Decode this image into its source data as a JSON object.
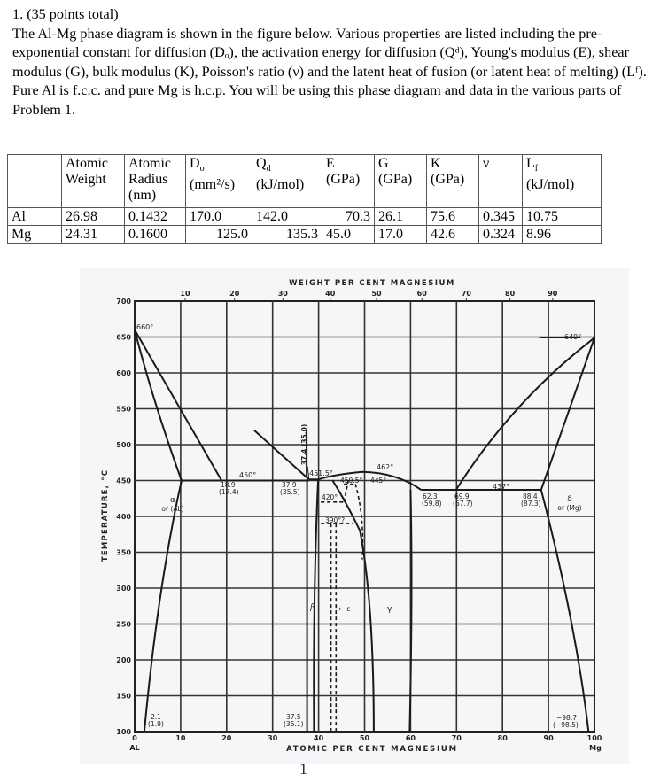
{
  "problem": {
    "heading": "1. (35 points total)",
    "paragraph": "The Al-Mg phase diagram is shown in the figure below.  Various properties are listed including the pre-exponential constant for diffusion (Dₒ), the activation energy for diffusion (Qᵈ), Young's modulus (E), shear modulus (G), bulk modulus (K), Poisson's ratio (ν) and the latent heat of fusion (or latent heat of melting) (Lᶠ).  Pure Al is f.c.c. and pure Mg is h.c.p.  You will be using this phase diagram and data in the various parts of Problem 1."
  },
  "table": {
    "headers": [
      {
        "line1": "",
        "line2": "",
        "line3": ""
      },
      {
        "line1": "Atomic",
        "line2": "Weight",
        "line3": ""
      },
      {
        "line1": "Atomic",
        "line2": "Radius",
        "line3": "(nm)"
      },
      {
        "line1": "D",
        "sub": "o",
        "line2": "(mm²/s)",
        "line3": ""
      },
      {
        "line1": "Q",
        "sub": "d",
        "line2": "(kJ/mol)",
        "line3": ""
      },
      {
        "line1": "E",
        "line2": "(GPa)",
        "line3": ""
      },
      {
        "line1": "G",
        "line2": "(GPa)",
        "line3": ""
      },
      {
        "line1": "K",
        "line2": "(GPa)",
        "line3": ""
      },
      {
        "line1": "ν",
        "line2": "",
        "line3": ""
      },
      {
        "line1": "L",
        "sub": "f",
        "line2": "(kJ/mol)",
        "line3": ""
      }
    ],
    "rows": [
      {
        "element": "Al",
        "atomic_weight": "26.98",
        "atomic_radius": "0.1432",
        "D0": "170.0",
        "Qd": "142.0",
        "E": "70.3",
        "G": "26.1",
        "K": "75.6",
        "nu": "0.345",
        "Lf": "10.75"
      },
      {
        "element": "Mg",
        "atomic_weight": "24.31",
        "atomic_radius": "0.1600",
        "D0": "125.0",
        "Qd": "135.3",
        "E": "45.0",
        "G": "17.0",
        "K": "42.6",
        "nu": "0.324",
        "Lf": "8.96"
      }
    ]
  },
  "figure": {
    "top_axis_label": "WEIGHT PER CENT MAGNESIUM",
    "top_ticks": [
      "10",
      "20",
      "30",
      "40",
      "50",
      "60",
      "70",
      "80",
      "90"
    ],
    "bottom_axis_label": "ATOMIC PER CENT MAGNESIUM",
    "bottom_ticks": [
      "0",
      "10",
      "20",
      "30",
      "40",
      "50",
      "60",
      "70",
      "80",
      "90",
      "100"
    ],
    "bottom_left_element": "AL",
    "bottom_right_element": "Mg",
    "y_axis_label": "TEMPERATURE, °C",
    "y_ticks": [
      "700",
      "650",
      "600",
      "550",
      "500",
      "450",
      "400",
      "350",
      "300",
      "250",
      "200",
      "150",
      "100"
    ],
    "annotations": {
      "al_melt": "660°",
      "mg_melt": "649°",
      "eutectic_left": "450°",
      "left_comp": "18.9",
      "left_comp_wt": "(17.4)",
      "beta_comp": "37.9",
      "beta_comp_wt": "(35.5)",
      "beta_peak": "451.5°",
      "beta_vertical": "37.4 (35.0)",
      "gamma_peak": "462°",
      "t4505": "450.5°",
      "t445": "445°",
      "t420": "420°",
      "t390": "390°?",
      "eutectic_right": "437°",
      "r1": "62.3",
      "r1w": "(59.8)",
      "r2": "69.9",
      "r2w": "(67.7)",
      "r3": "88.4",
      "r3w": "(87.3)",
      "alpha": "α",
      "alpha_sub": "or (AL)",
      "delta": "δ",
      "delta_sub": "or (Mg)",
      "beta": "β",
      "epsilon": "← ε",
      "gamma": "γ",
      "low_left": "2.1",
      "low_left_w": "(1.9)",
      "low_mid": "37.5",
      "low_mid_w": "(35.1)",
      "low_right": "~98.7",
      "low_right_w": "(~98.5)"
    }
  },
  "page_number": "1"
}
